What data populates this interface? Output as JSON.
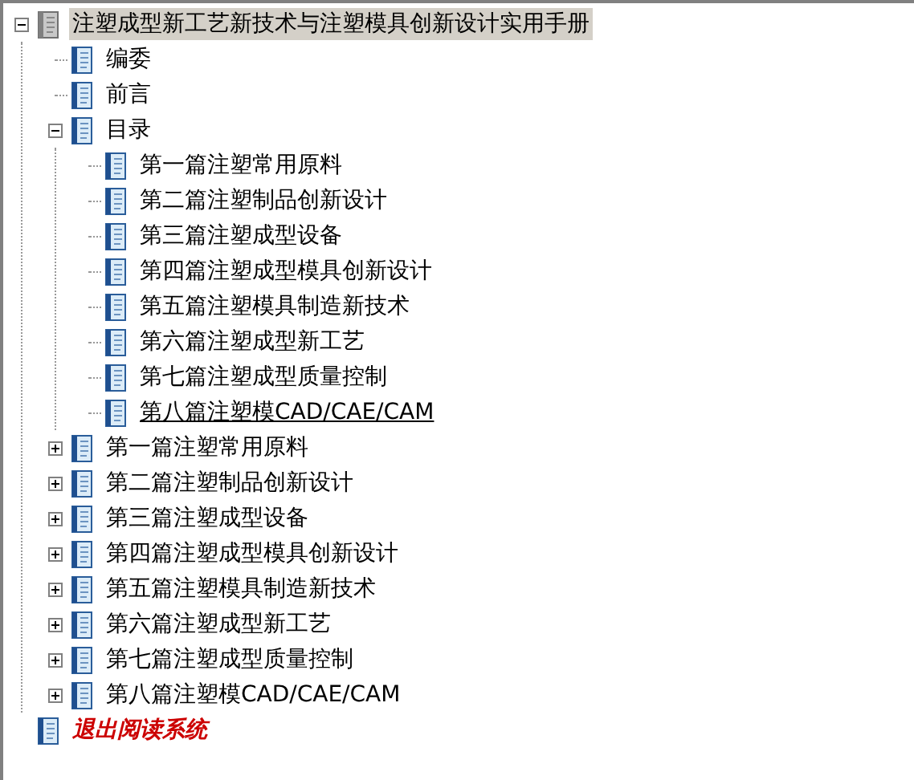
{
  "tree": [
    {
      "label": "注塑成型新工艺新技术与注塑模具创新设计实用手册",
      "kind": "volume",
      "selected": true,
      "hovered": false,
      "expanded": true,
      "children": [
        {
          "label": "编委",
          "kind": "page",
          "selected": false,
          "hovered": false
        },
        {
          "label": "前言",
          "kind": "page",
          "selected": false,
          "hovered": false
        },
        {
          "label": "目录",
          "kind": "page",
          "selected": false,
          "hovered": false,
          "expanded": true,
          "children": [
            {
              "label": "第一篇注塑常用原料",
              "kind": "page",
              "selected": false,
              "hovered": false
            },
            {
              "label": "第二篇注塑制品创新设计",
              "kind": "page",
              "selected": false,
              "hovered": false
            },
            {
              "label": "第三篇注塑成型设备",
              "kind": "page",
              "selected": false,
              "hovered": false
            },
            {
              "label": "第四篇注塑成型模具创新设计",
              "kind": "page",
              "selected": false,
              "hovered": false
            },
            {
              "label": "第五篇注塑模具制造新技术",
              "kind": "page",
              "selected": false,
              "hovered": false
            },
            {
              "label": "第六篇注塑成型新工艺",
              "kind": "page",
              "selected": false,
              "hovered": false
            },
            {
              "label": "第七篇注塑成型质量控制",
              "kind": "page",
              "selected": false,
              "hovered": false
            },
            {
              "label": "第八篇注塑模CAD/CAE/CAM",
              "kind": "page",
              "selected": false,
              "hovered": true
            }
          ]
        },
        {
          "label": "第一篇注塑常用原料",
          "kind": "page",
          "selected": false,
          "hovered": false,
          "expanded": false
        },
        {
          "label": "第二篇注塑制品创新设计",
          "kind": "page",
          "selected": false,
          "hovered": false,
          "expanded": false
        },
        {
          "label": "第三篇注塑成型设备",
          "kind": "page",
          "selected": false,
          "hovered": false,
          "expanded": false
        },
        {
          "label": "第四篇注塑成型模具创新设计",
          "kind": "page",
          "selected": false,
          "hovered": false,
          "expanded": false
        },
        {
          "label": "第五篇注塑模具制造新技术",
          "kind": "page",
          "selected": false,
          "hovered": false,
          "expanded": false
        },
        {
          "label": "第六篇注塑成型新工艺",
          "kind": "page",
          "selected": false,
          "hovered": false,
          "expanded": false
        },
        {
          "label": "第七篇注塑成型质量控制",
          "kind": "page",
          "selected": false,
          "hovered": false,
          "expanded": false
        },
        {
          "label": "第八篇注塑模CAD/CAE/CAM",
          "kind": "page",
          "selected": false,
          "hovered": false,
          "expanded": false
        }
      ]
    },
    {
      "label": "退出阅读系统",
      "kind": "exit",
      "selected": false,
      "hovered": false
    }
  ]
}
